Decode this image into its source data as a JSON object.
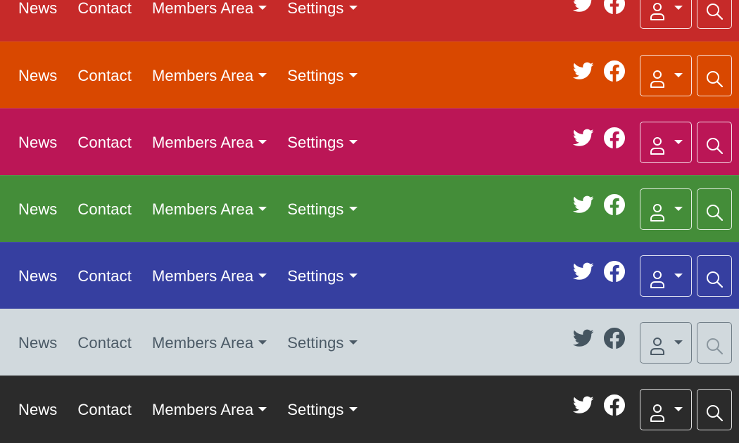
{
  "nav": {
    "links": [
      {
        "label": "News",
        "dropdown": false
      },
      {
        "label": "Contact",
        "dropdown": false
      },
      {
        "label": "Members Area",
        "dropdown": true
      },
      {
        "label": "Settings",
        "dropdown": true
      }
    ],
    "social_icons": [
      "twitter-icon",
      "facebook-icon"
    ],
    "user_button_icon": "user-icon",
    "search_button_icon": "search-icon"
  },
  "variants": [
    {
      "name": "red",
      "bg": "#c62a29",
      "fg": "#ffffff",
      "border": "rgba(255,255,255,0.85)"
    },
    {
      "name": "orange",
      "bg": "#d94800",
      "fg": "#ffffff",
      "border": "rgba(255,255,255,0.85)"
    },
    {
      "name": "pink",
      "bg": "#bb1656",
      "fg": "#ffffff",
      "border": "rgba(255,255,255,0.85)"
    },
    {
      "name": "green",
      "bg": "#448d39",
      "fg": "#ffffff",
      "border": "rgba(255,255,255,0.85)"
    },
    {
      "name": "indigo",
      "bg": "#363fa0",
      "fg": "#ffffff",
      "border": "rgba(255,255,255,0.85)"
    },
    {
      "name": "light",
      "bg": "#d1d9dd",
      "fg": "#4b5a66",
      "border": "#6f7c85",
      "icon": "#455560",
      "search": "#8a969e"
    },
    {
      "name": "dark",
      "bg": "#2b2b2b",
      "fg": "#ffffff",
      "border": "rgba(255,255,255,0.85)"
    }
  ]
}
